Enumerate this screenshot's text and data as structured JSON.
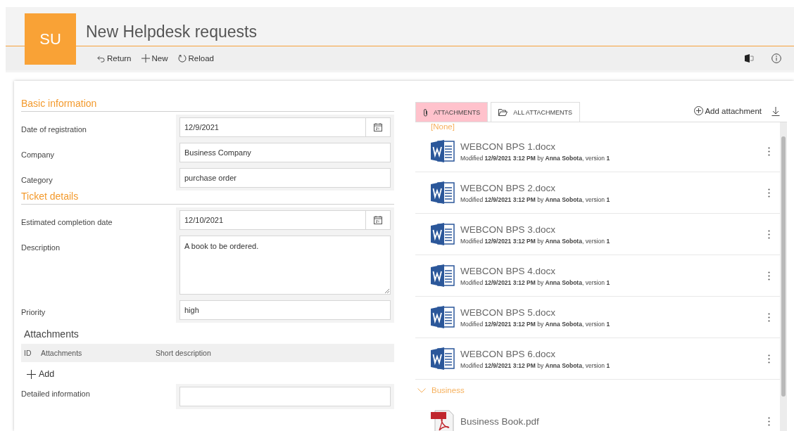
{
  "header": {
    "logo": "SU",
    "title": "New Helpdesk requests",
    "actions": [
      {
        "label": "Return",
        "kind": "return"
      },
      {
        "label": "New",
        "kind": "new"
      },
      {
        "label": "Reload",
        "kind": "reload"
      }
    ]
  },
  "form": {
    "sections": [
      {
        "title": "Basic information",
        "fields": [
          {
            "label": "Date of registration",
            "value": "12/9/2021",
            "kind": "date"
          },
          {
            "label": "Company",
            "value": "Business Company",
            "kind": "text"
          },
          {
            "label": "Category",
            "value": "purchase order",
            "kind": "text"
          }
        ]
      },
      {
        "title": "Ticket details",
        "fields": [
          {
            "label": "Estimated completion date",
            "value": "12/10/2021",
            "kind": "date"
          },
          {
            "label": "Description",
            "value": "A book to be ordered.",
            "kind": "textarea"
          },
          {
            "label": "Priority",
            "value": "high",
            "kind": "text"
          }
        ]
      }
    ],
    "attachments_table": {
      "title": "Attachments",
      "columns": [
        "ID",
        "Attachments",
        "Short description"
      ],
      "add_label": "Add"
    },
    "detailed_information": {
      "label": "Detailed information"
    }
  },
  "attachments_panel": {
    "tabs": [
      {
        "label": "ATTACHMENTS",
        "selected": true,
        "kind": "clip"
      },
      {
        "label": "ALL ATTACHMENTS",
        "selected": false,
        "kind": "folder"
      }
    ],
    "add_attachment": "Add attachment",
    "groups": [
      {
        "name": "[None]",
        "files": [
          {
            "name": "WEBCON BPS 1.docx",
            "kind": "word",
            "meta": "Modified **12/9/2021 3:12 PM** by **Anna Sobota**, version **1**"
          },
          {
            "name": "WEBCON BPS 2.docx",
            "kind": "word",
            "meta": "Modified **12/9/2021 3:12 PM** by **Anna Sobota**, version **1**"
          },
          {
            "name": "WEBCON BPS 3.docx",
            "kind": "word",
            "meta": "Modified **12/9/2021 3:12 PM** by **Anna Sobota**, version **1**"
          },
          {
            "name": "WEBCON BPS 4.docx",
            "kind": "word",
            "meta": "Modified **12/9/2021 3:12 PM** by **Anna Sobota**, version **1**"
          },
          {
            "name": "WEBCON BPS 5.docx",
            "kind": "word",
            "meta": "Modified **12/9/2021 3:12 PM** by **Anna Sobota**, version **1**"
          },
          {
            "name": "WEBCON BPS 6.docx",
            "kind": "word",
            "meta": "Modified **12/9/2021 3:12 PM** by **Anna Sobota**, version **1**"
          }
        ]
      },
      {
        "name": "Business",
        "expanded": true,
        "files": [
          {
            "name": "Business Book.pdf",
            "kind": "pdf"
          }
        ]
      }
    ]
  }
}
